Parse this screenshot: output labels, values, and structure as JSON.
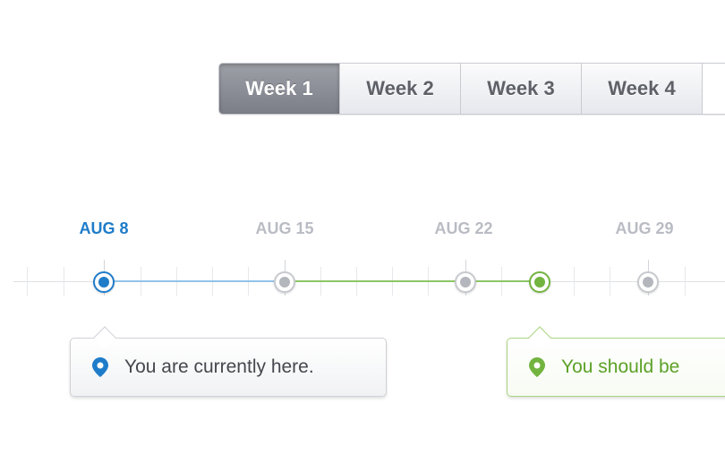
{
  "week_tabs": [
    {
      "label": "Week 1",
      "active": true
    },
    {
      "label": "Week 2",
      "active": false
    },
    {
      "label": "Week 3",
      "active": false
    },
    {
      "label": "Week 4",
      "active": false
    }
  ],
  "dates": [
    {
      "label": "AUG 8",
      "current": true
    },
    {
      "label": "AUG 15",
      "current": false
    },
    {
      "label": "AUG 22",
      "current": false
    },
    {
      "label": "AUG 29",
      "current": false
    }
  ],
  "callouts": {
    "current": {
      "text": "You are currently here.",
      "icon": "map-pin-icon"
    },
    "target": {
      "text": "You should be",
      "icon": "map-pin-icon"
    }
  },
  "colors": {
    "current": "#1f7cc9",
    "target": "#72b43f",
    "inactive": "#b4b6bd"
  }
}
